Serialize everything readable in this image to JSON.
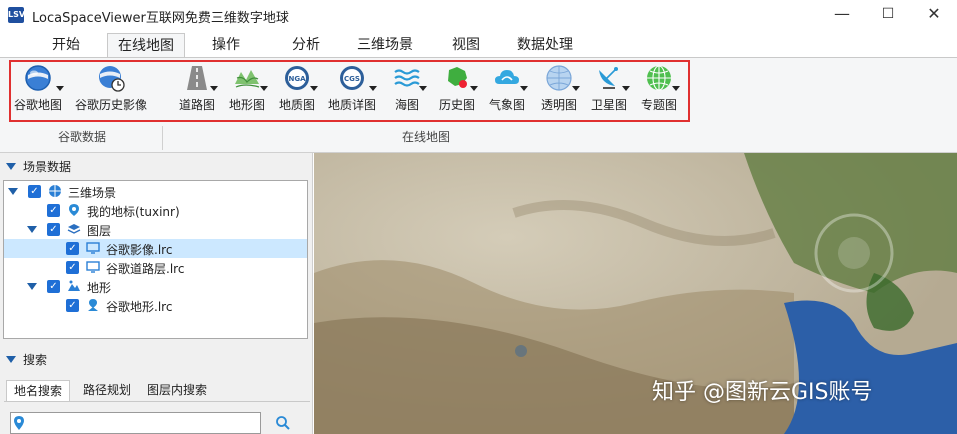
{
  "app": {
    "title": "LocaSpaceViewer互联网免费三维数字地球",
    "icon_text": "LSV"
  },
  "window_controls": {
    "minimize": "—",
    "maximize": "☐",
    "close": "✕"
  },
  "menu": {
    "tabs": [
      "开始",
      "在线地图",
      "操作",
      "分析",
      "三维场景",
      "视图",
      "数据处理"
    ],
    "active": "在线地图"
  },
  "ribbon": {
    "groups": [
      {
        "name": "谷歌数据",
        "buttons": [
          {
            "label": "谷歌地图",
            "icon": "google-globe-icon",
            "dropdown": true
          },
          {
            "label": "谷歌历史影像",
            "icon": "google-history-icon",
            "dropdown": false
          }
        ]
      },
      {
        "name": "在线地图",
        "buttons": [
          {
            "label": "道路图",
            "icon": "road-icon",
            "dropdown": true
          },
          {
            "label": "地形图",
            "icon": "terrain-icon",
            "dropdown": true
          },
          {
            "label": "地质图",
            "icon": "geology-nga-icon",
            "dropdown": true
          },
          {
            "label": "地质详图",
            "icon": "geology-cgs-icon",
            "dropdown": true
          },
          {
            "label": "海图",
            "icon": "sea-chart-icon",
            "dropdown": true
          },
          {
            "label": "历史图",
            "icon": "history-map-icon",
            "dropdown": true
          },
          {
            "label": "气象图",
            "icon": "weather-icon",
            "dropdown": true
          },
          {
            "label": "透明图",
            "icon": "transparent-globe-icon",
            "dropdown": true
          },
          {
            "label": "卫星图",
            "icon": "satellite-dish-icon",
            "dropdown": true
          },
          {
            "label": "专题图",
            "icon": "thematic-globe-icon",
            "dropdown": true
          }
        ]
      }
    ]
  },
  "scene_panel": {
    "title": "场景数据",
    "tree": [
      {
        "label": "三维场景",
        "icon": "globe-icon",
        "level": 0,
        "expander": true,
        "selected": false
      },
      {
        "label": "我的地标(tuxinr)",
        "icon": "placemark-icon",
        "level": 1,
        "expander": false,
        "selected": false
      },
      {
        "label": "图层",
        "icon": "layers-icon",
        "level": 1,
        "expander": true,
        "selected": false
      },
      {
        "label": "谷歌影像.lrc",
        "icon": "monitor-icon",
        "level": 2,
        "expander": false,
        "selected": true
      },
      {
        "label": "谷歌道路层.lrc",
        "icon": "monitor-icon",
        "level": 2,
        "expander": false,
        "selected": false
      },
      {
        "label": "地形",
        "icon": "terrain-small-icon",
        "level": 1,
        "expander": true,
        "selected": false
      },
      {
        "label": "谷歌地形.lrc",
        "icon": "terrain-layer-icon",
        "level": 2,
        "expander": false,
        "selected": false
      }
    ]
  },
  "search_panel": {
    "title": "搜索",
    "tabs": [
      "地名搜索",
      "路径规划",
      "图层内搜索"
    ],
    "active_tab": "地名搜索",
    "input_value": ""
  },
  "map": {
    "watermark": "知乎 @图新云GIS账号"
  }
}
